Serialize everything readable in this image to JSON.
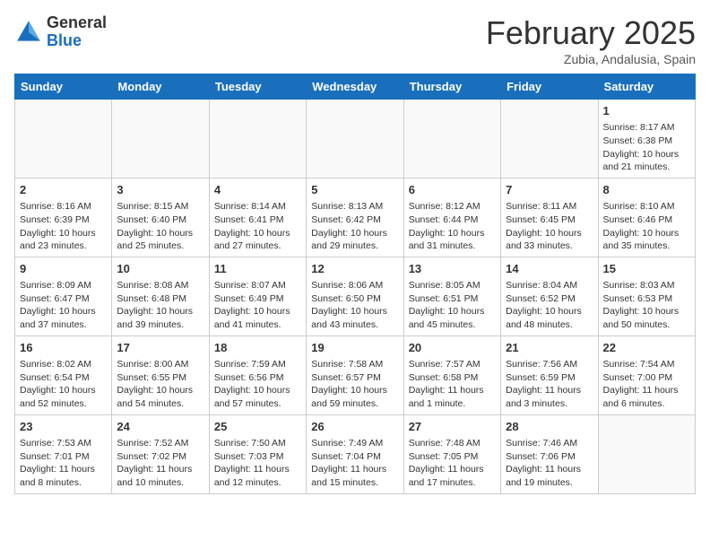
{
  "logo": {
    "general": "General",
    "blue": "Blue"
  },
  "header": {
    "month": "February 2025",
    "location": "Zubia, Andalusia, Spain"
  },
  "weekdays": [
    "Sunday",
    "Monday",
    "Tuesday",
    "Wednesday",
    "Thursday",
    "Friday",
    "Saturday"
  ],
  "weeks": [
    [
      {
        "day": "",
        "info": ""
      },
      {
        "day": "",
        "info": ""
      },
      {
        "day": "",
        "info": ""
      },
      {
        "day": "",
        "info": ""
      },
      {
        "day": "",
        "info": ""
      },
      {
        "day": "",
        "info": ""
      },
      {
        "day": "1",
        "info": "Sunrise: 8:17 AM\nSunset: 6:38 PM\nDaylight: 10 hours and 21 minutes."
      }
    ],
    [
      {
        "day": "2",
        "info": "Sunrise: 8:16 AM\nSunset: 6:39 PM\nDaylight: 10 hours and 23 minutes."
      },
      {
        "day": "3",
        "info": "Sunrise: 8:15 AM\nSunset: 6:40 PM\nDaylight: 10 hours and 25 minutes."
      },
      {
        "day": "4",
        "info": "Sunrise: 8:14 AM\nSunset: 6:41 PM\nDaylight: 10 hours and 27 minutes."
      },
      {
        "day": "5",
        "info": "Sunrise: 8:13 AM\nSunset: 6:42 PM\nDaylight: 10 hours and 29 minutes."
      },
      {
        "day": "6",
        "info": "Sunrise: 8:12 AM\nSunset: 6:44 PM\nDaylight: 10 hours and 31 minutes."
      },
      {
        "day": "7",
        "info": "Sunrise: 8:11 AM\nSunset: 6:45 PM\nDaylight: 10 hours and 33 minutes."
      },
      {
        "day": "8",
        "info": "Sunrise: 8:10 AM\nSunset: 6:46 PM\nDaylight: 10 hours and 35 minutes."
      }
    ],
    [
      {
        "day": "9",
        "info": "Sunrise: 8:09 AM\nSunset: 6:47 PM\nDaylight: 10 hours and 37 minutes."
      },
      {
        "day": "10",
        "info": "Sunrise: 8:08 AM\nSunset: 6:48 PM\nDaylight: 10 hours and 39 minutes."
      },
      {
        "day": "11",
        "info": "Sunrise: 8:07 AM\nSunset: 6:49 PM\nDaylight: 10 hours and 41 minutes."
      },
      {
        "day": "12",
        "info": "Sunrise: 8:06 AM\nSunset: 6:50 PM\nDaylight: 10 hours and 43 minutes."
      },
      {
        "day": "13",
        "info": "Sunrise: 8:05 AM\nSunset: 6:51 PM\nDaylight: 10 hours and 45 minutes."
      },
      {
        "day": "14",
        "info": "Sunrise: 8:04 AM\nSunset: 6:52 PM\nDaylight: 10 hours and 48 minutes."
      },
      {
        "day": "15",
        "info": "Sunrise: 8:03 AM\nSunset: 6:53 PM\nDaylight: 10 hours and 50 minutes."
      }
    ],
    [
      {
        "day": "16",
        "info": "Sunrise: 8:02 AM\nSunset: 6:54 PM\nDaylight: 10 hours and 52 minutes."
      },
      {
        "day": "17",
        "info": "Sunrise: 8:00 AM\nSunset: 6:55 PM\nDaylight: 10 hours and 54 minutes."
      },
      {
        "day": "18",
        "info": "Sunrise: 7:59 AM\nSunset: 6:56 PM\nDaylight: 10 hours and 57 minutes."
      },
      {
        "day": "19",
        "info": "Sunrise: 7:58 AM\nSunset: 6:57 PM\nDaylight: 10 hours and 59 minutes."
      },
      {
        "day": "20",
        "info": "Sunrise: 7:57 AM\nSunset: 6:58 PM\nDaylight: 11 hours and 1 minute."
      },
      {
        "day": "21",
        "info": "Sunrise: 7:56 AM\nSunset: 6:59 PM\nDaylight: 11 hours and 3 minutes."
      },
      {
        "day": "22",
        "info": "Sunrise: 7:54 AM\nSunset: 7:00 PM\nDaylight: 11 hours and 6 minutes."
      }
    ],
    [
      {
        "day": "23",
        "info": "Sunrise: 7:53 AM\nSunset: 7:01 PM\nDaylight: 11 hours and 8 minutes."
      },
      {
        "day": "24",
        "info": "Sunrise: 7:52 AM\nSunset: 7:02 PM\nDaylight: 11 hours and 10 minutes."
      },
      {
        "day": "25",
        "info": "Sunrise: 7:50 AM\nSunset: 7:03 PM\nDaylight: 11 hours and 12 minutes."
      },
      {
        "day": "26",
        "info": "Sunrise: 7:49 AM\nSunset: 7:04 PM\nDaylight: 11 hours and 15 minutes."
      },
      {
        "day": "27",
        "info": "Sunrise: 7:48 AM\nSunset: 7:05 PM\nDaylight: 11 hours and 17 minutes."
      },
      {
        "day": "28",
        "info": "Sunrise: 7:46 AM\nSunset: 7:06 PM\nDaylight: 11 hours and 19 minutes."
      },
      {
        "day": "",
        "info": ""
      }
    ]
  ]
}
